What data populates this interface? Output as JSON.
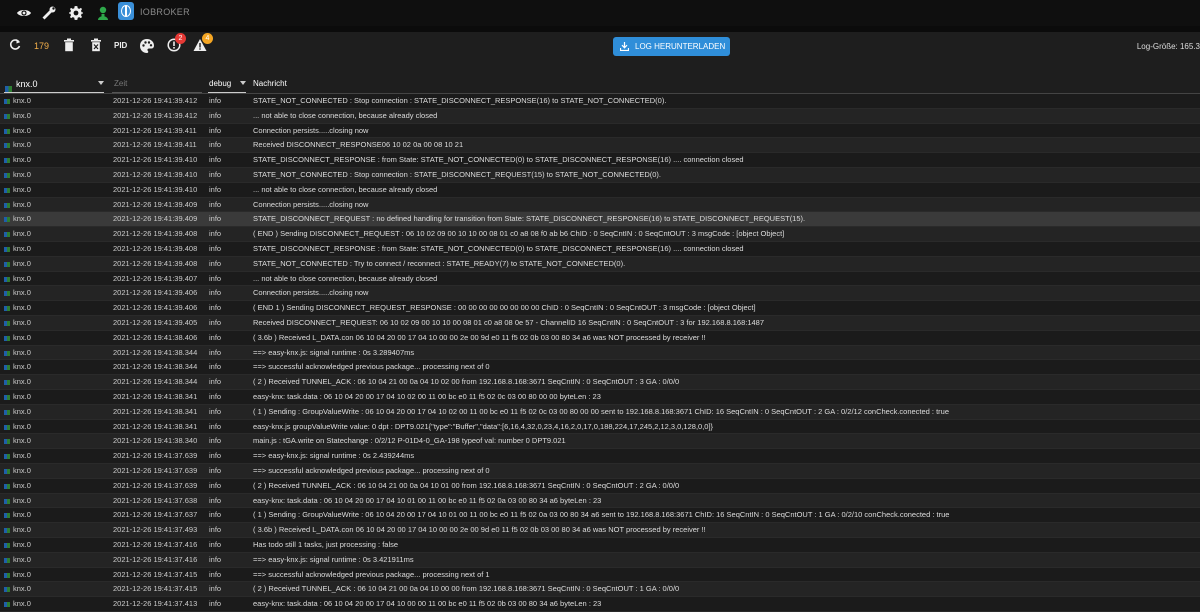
{
  "topbar": {
    "brand": "IOBROKER",
    "icons": [
      "eye-icon",
      "wrench-icon",
      "gear-icon",
      "user-icon",
      "iobroker-logo"
    ]
  },
  "toolbar": {
    "count": "179",
    "pid_label": "PID",
    "error_badge": "2",
    "warning_badge": "4",
    "download_label": "LOG HERUNTERLADEN",
    "log_size": "Log-Größe: 165.3"
  },
  "colors": {
    "accent": "#2f8ed9",
    "count": "#f5b04a",
    "error": "#e53935",
    "warning": "#f5a623"
  },
  "header": {
    "instance": "knx.0",
    "time_placeholder": "Zeit",
    "level": "debug",
    "message": "Nachricht"
  },
  "rows": [
    {
      "inst": "knx.0",
      "time": "2021-12-26 19:41:39.412",
      "lvl": "info",
      "msg": "STATE_NOT_CONNECTED : Stop connection : STATE_DISCONNECT_RESPONSE(16) to STATE_NOT_CONNECTED(0)."
    },
    {
      "inst": "knx.0",
      "time": "2021-12-26 19:41:39.412",
      "lvl": "info",
      "msg": "... not able to close connection, because already closed"
    },
    {
      "inst": "knx.0",
      "time": "2021-12-26 19:41:39.411",
      "lvl": "info",
      "msg": "Connection persists.....closing now"
    },
    {
      "inst": "knx.0",
      "time": "2021-12-26 19:41:39.411",
      "lvl": "info",
      "msg": "Received DISCONNECT_RESPONSE06 10 02 0a 00 08 10 21"
    },
    {
      "inst": "knx.0",
      "time": "2021-12-26 19:41:39.410",
      "lvl": "info",
      "msg": "STATE_DISCONNECT_RESPONSE : from State: STATE_NOT_CONNECTED(0) to STATE_DISCONNECT_RESPONSE(16) .... connection closed"
    },
    {
      "inst": "knx.0",
      "time": "2021-12-26 19:41:39.410",
      "lvl": "info",
      "msg": "STATE_NOT_CONNECTED : Stop connection : STATE_DISCONNECT_REQUEST(15) to STATE_NOT_CONNECTED(0)."
    },
    {
      "inst": "knx.0",
      "time": "2021-12-26 19:41:39.410",
      "lvl": "info",
      "msg": "... not able to close connection, because already closed"
    },
    {
      "inst": "knx.0",
      "time": "2021-12-26 19:41:39.409",
      "lvl": "info",
      "msg": "Connection persists.....closing now"
    },
    {
      "inst": "knx.0",
      "time": "2021-12-26 19:41:39.409",
      "lvl": "info",
      "msg": "STATE_DISCONNECT_REQUEST : no defined handling for transition from State: STATE_DISCONNECT_RESPONSE(16) to STATE_DISCONNECT_REQUEST(15)."
    },
    {
      "inst": "knx.0",
      "time": "2021-12-26 19:41:39.408",
      "lvl": "info",
      "msg": "( END ) Sending DISCONNECT_REQUEST : 06 10 02 09 00 10 10 00 08 01 c0 a8 08 f0 ab b6 ChID : 0 SeqCntIN : 0 SeqCntOUT : 3 msgCode : [object Object]"
    },
    {
      "inst": "knx.0",
      "time": "2021-12-26 19:41:39.408",
      "lvl": "info",
      "msg": "STATE_DISCONNECT_RESPONSE : from State: STATE_NOT_CONNECTED(0) to STATE_DISCONNECT_RESPONSE(16) .... connection closed"
    },
    {
      "inst": "knx.0",
      "time": "2021-12-26 19:41:39.408",
      "lvl": "info",
      "msg": "STATE_NOT_CONNECTED : Try to connect / reconnect : STATE_READY(7) to STATE_NOT_CONNECTED(0)."
    },
    {
      "inst": "knx.0",
      "time": "2021-12-26 19:41:39.407",
      "lvl": "info",
      "msg": "... not able to close connection, because already closed"
    },
    {
      "inst": "knx.0",
      "time": "2021-12-26 19:41:39.406",
      "lvl": "info",
      "msg": "Connection persists.....closing now"
    },
    {
      "inst": "knx.0",
      "time": "2021-12-26 19:41:39.406",
      "lvl": "info",
      "msg": "( END 1 ) Sending DISCONNECT_REQUEST_RESPONSE : 00 00 00 00 00 00 00 00 ChID : 0 SeqCntIN : 0 SeqCntOUT : 3 msgCode : [object Object]"
    },
    {
      "inst": "knx.0",
      "time": "2021-12-26 19:41:39.405",
      "lvl": "info",
      "msg": "Received DISCONNECT_REQUEST: 06 10 02 09 00 10 10 00 08 01 c0 a8 08 0e 57 - ChannelID 16 SeqCntIN : 0 SeqCntOUT : 3 for 192.168.8.168:1487"
    },
    {
      "inst": "knx.0",
      "time": "2021-12-26 19:41:38.406",
      "lvl": "info",
      "msg": "( 3.6b ) Received L_DATA.con 06 10 04 20 00 17 04 10 00 00 2e 00 9d e0 11 f5 02 0b 03 00 80 34 a6 was NOT processed by receiver !!"
    },
    {
      "inst": "knx.0",
      "time": "2021-12-26 19:41:38.344",
      "lvl": "info",
      "msg": "==> easy-knx.js: signal runtime : 0s 3.289407ms"
    },
    {
      "inst": "knx.0",
      "time": "2021-12-26 19:41:38.344",
      "lvl": "info",
      "msg": "==> successful acknowledged previous package... processing next of 0"
    },
    {
      "inst": "knx.0",
      "time": "2021-12-26 19:41:38.344",
      "lvl": "info",
      "msg": "( 2 ) Received TUNNEL_ACK : 06 10 04 21 00 0a 04 10 02 00 from 192.168.8.168:3671 SeqCntIN : 0 SeqCntOUT : 3 GA : 0/0/0"
    },
    {
      "inst": "knx.0",
      "time": "2021-12-26 19:41:38.341",
      "lvl": "info",
      "msg": "easy-knx: task.data : 06 10 04 20 00 17 04 10 02 00 11 00 bc e0 11 f5 02 0c 03 00 80 00 00 byteLen : 23"
    },
    {
      "inst": "knx.0",
      "time": "2021-12-26 19:41:38.341",
      "lvl": "info",
      "msg": "( 1 ) Sending : GroupValueWrite : 06 10 04 20 00 17 04 10 02 00 11 00 bc e0 11 f5 02 0c 03 00 80 00 00 sent to 192.168.8.168:3671 ChID: 16 SeqCntIN : 0 SeqCntOUT : 2 GA : 0/2/12 conCheck.conected : true"
    },
    {
      "inst": "knx.0",
      "time": "2021-12-26 19:41:38.341",
      "lvl": "info",
      "msg": "easy-knx.js groupValueWrite value: 0 dpt : DPT9.021{\"type\":\"Buffer\",\"data\":[6,16,4,32,0,23,4,16,2,0,17,0,188,224,17,245,2,12,3,0,128,0,0]}"
    },
    {
      "inst": "knx.0",
      "time": "2021-12-26 19:41:38.340",
      "lvl": "info",
      "msg": "main.js : tGA.write on Statechange : 0/2/12 P-01D4-0_GA-198 typeof val: number 0 DPT9.021"
    },
    {
      "inst": "knx.0",
      "time": "2021-12-26 19:41:37.639",
      "lvl": "info",
      "msg": "==> easy-knx.js: signal runtime : 0s 2.439244ms"
    },
    {
      "inst": "knx.0",
      "time": "2021-12-26 19:41:37.639",
      "lvl": "info",
      "msg": "==> successful acknowledged previous package... processing next of 0"
    },
    {
      "inst": "knx.0",
      "time": "2021-12-26 19:41:37.639",
      "lvl": "info",
      "msg": "( 2 ) Received TUNNEL_ACK : 06 10 04 21 00 0a 04 10 01 00 from 192.168.8.168:3671 SeqCntIN : 0 SeqCntOUT : 2 GA : 0/0/0"
    },
    {
      "inst": "knx.0",
      "time": "2021-12-26 19:41:37.638",
      "lvl": "info",
      "msg": "easy-knx: task.data : 06 10 04 20 00 17 04 10 01 00 11 00 bc e0 11 f5 02 0a 03 00 80 34 a6 byteLen : 23"
    },
    {
      "inst": "knx.0",
      "time": "2021-12-26 19:41:37.637",
      "lvl": "info",
      "msg": "( 1 ) Sending : GroupValueWrite : 06 10 04 20 00 17 04 10 01 00 11 00 bc e0 11 f5 02 0a 03 00 80 34 a6 sent to 192.168.8.168:3671 ChID: 16 SeqCntIN : 0 SeqCntOUT : 1 GA : 0/2/10 conCheck.conected : true"
    },
    {
      "inst": "knx.0",
      "time": "2021-12-26 19:41:37.493",
      "lvl": "info",
      "msg": "( 3.6b ) Received L_DATA.con 06 10 04 20 00 17 04 10 00 00 2e 00 9d e0 11 f5 02 0b 03 00 80 34 a6 was NOT processed by receiver !!"
    },
    {
      "inst": "knx.0",
      "time": "2021-12-26 19:41:37.416",
      "lvl": "info",
      "msg": "Has todo still 1 tasks, just processing : false"
    },
    {
      "inst": "knx.0",
      "time": "2021-12-26 19:41:37.416",
      "lvl": "info",
      "msg": "==> easy-knx.js: signal runtime : 0s 3.421911ms"
    },
    {
      "inst": "knx.0",
      "time": "2021-12-26 19:41:37.415",
      "lvl": "info",
      "msg": "==> successful acknowledged previous package... processing next of 1"
    },
    {
      "inst": "knx.0",
      "time": "2021-12-26 19:41:37.415",
      "lvl": "info",
      "msg": "( 2 ) Received TUNNEL_ACK : 06 10 04 21 00 0a 04 10 00 00 from 192.168.8.168:3671 SeqCntIN : 0 SeqCntOUT : 1 GA : 0/0/0"
    },
    {
      "inst": "knx.0",
      "time": "2021-12-26 19:41:37.413",
      "lvl": "info",
      "msg": "easy-knx: task.data : 06 10 04 20 00 17 04 10 00 00 11 00 bc e0 11 f5 02 0b 03 00 80 34 a6 byteLen : 23"
    }
  ]
}
